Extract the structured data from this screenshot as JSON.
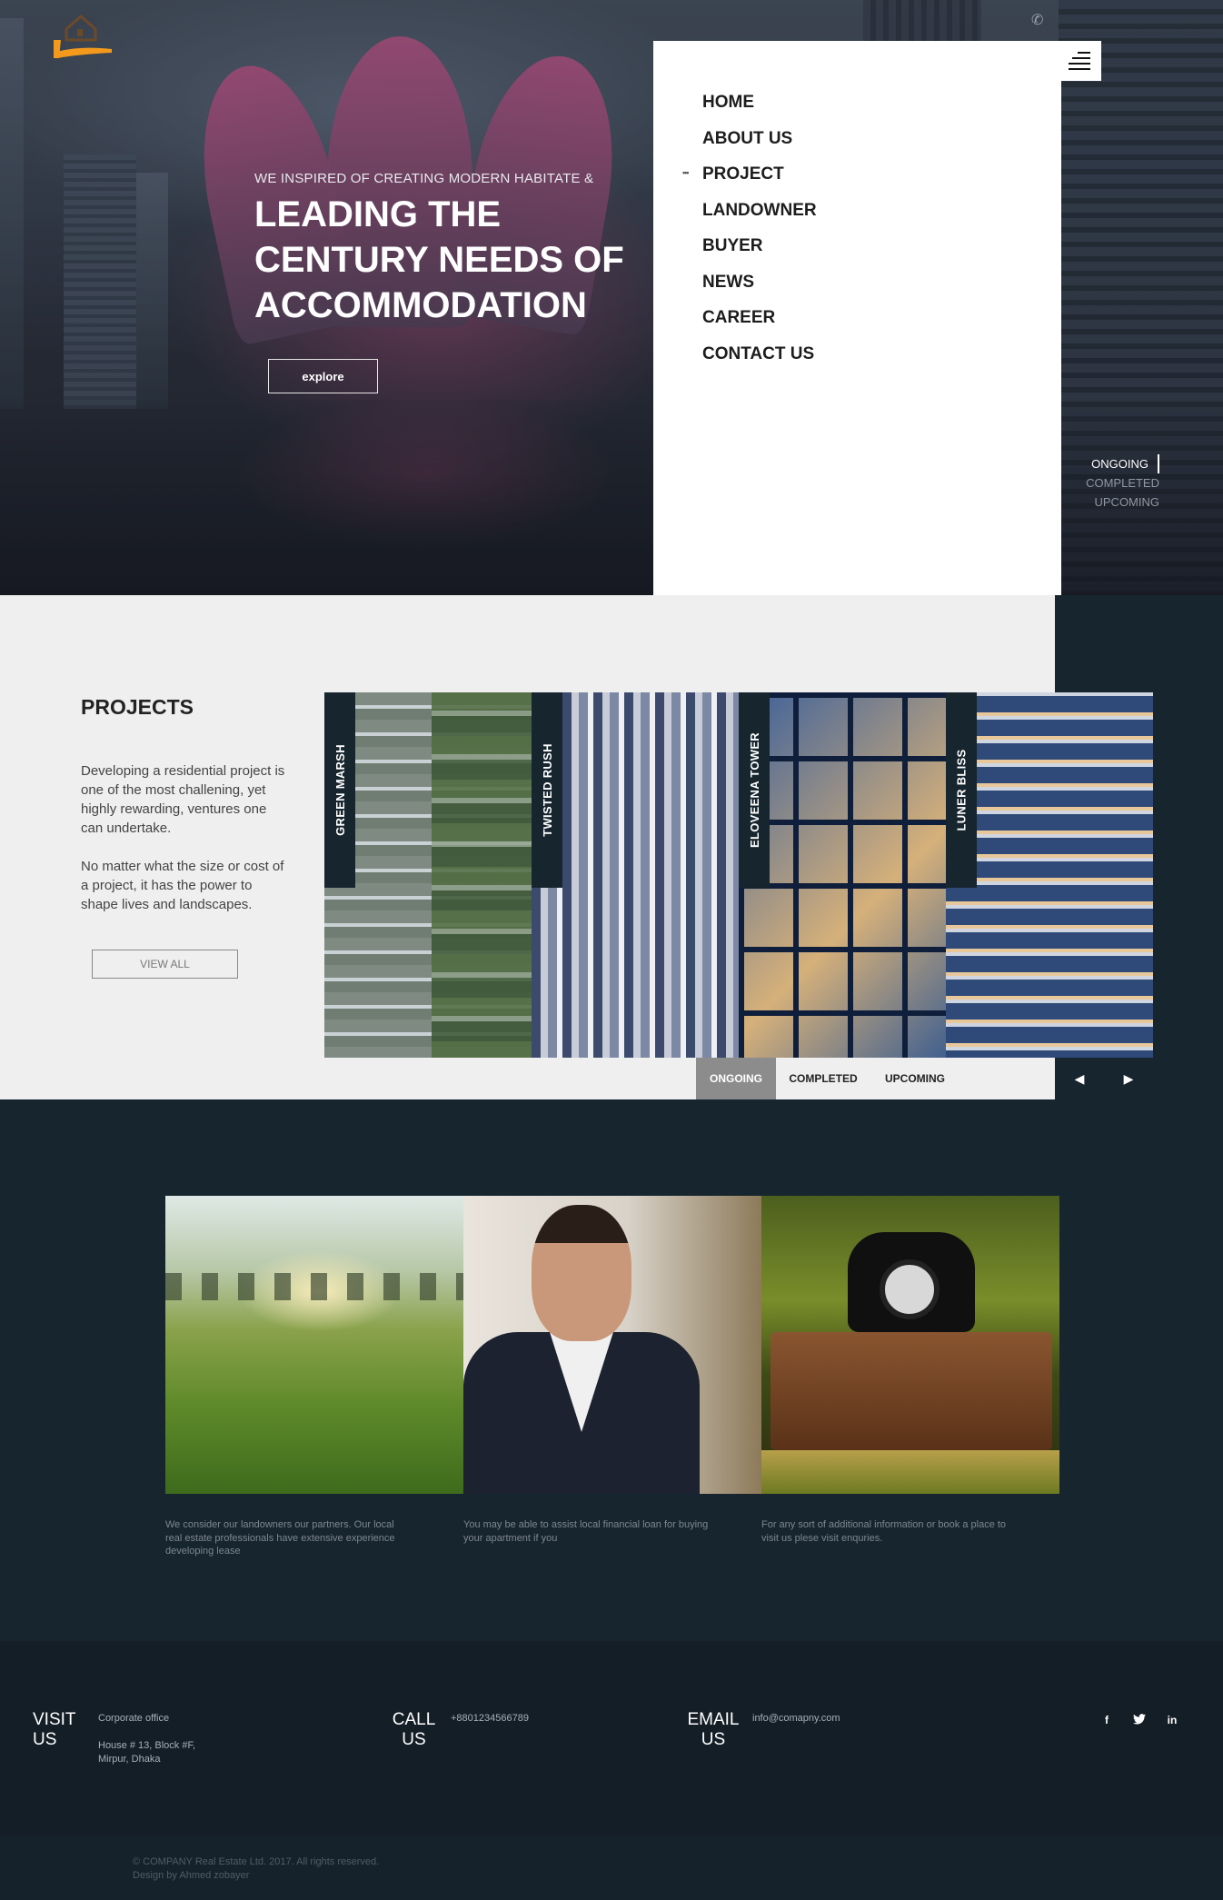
{
  "nav": {
    "items": [
      {
        "label": "HOME",
        "active": false
      },
      {
        "label": "ABOUT US",
        "active": false
      },
      {
        "label": "PROJECT",
        "active": true
      },
      {
        "label": "LANDOWNER",
        "active": false
      },
      {
        "label": "BUYER",
        "active": false
      },
      {
        "label": "NEWS",
        "active": false
      },
      {
        "label": "CAREER",
        "active": false
      },
      {
        "label": "CONTACT US",
        "active": false
      }
    ]
  },
  "hero": {
    "kicker": "WE INSPIRED OF CREATING MODERN HABITATE &",
    "title": "LEADING THE CENTURY NEEDS OF ACCOMMODATION",
    "explore_label": "explore",
    "status": {
      "ongoing": "ONGOING",
      "completed": "COMPLETED",
      "upcoming": "UPCOMING"
    }
  },
  "projects": {
    "title": "PROJECTS",
    "paragraph1": "Developing a residential project is one of the most challening, yet highly rewarding, ventures one can undertake.",
    "paragraph2": "No matter what the size or cost of a project, it has the power to shape lives and landscapes.",
    "view_all_label": "VIEW ALL",
    "cards": [
      {
        "name": "GREEN MARSH"
      },
      {
        "name": "TWISTED RUSH"
      },
      {
        "name": "ELOVEENA TOWER"
      },
      {
        "name": "LUNER BLISS"
      }
    ],
    "tabs": [
      {
        "label": "ONGOING",
        "active": true
      },
      {
        "label": "COMPLETED",
        "active": false
      },
      {
        "label": "UPCOMING",
        "active": false
      }
    ],
    "prev_icon": "◀",
    "next_icon": "▶"
  },
  "services": [
    {
      "text": "We consider our landowners our partners. Our local real estate professionals have extensive experience developing lease"
    },
    {
      "text": "You may be able to assist local financial loan for buying your apartment if you"
    },
    {
      "text": "For any sort of additional information or book a place to visit us plese visit enquries."
    }
  ],
  "footer": {
    "visit": {
      "heading": "VISIT US",
      "label": "Corporate office",
      "address": "House # 13, Block #F, Mirpur, Dhaka"
    },
    "call": {
      "heading": "CALL US",
      "value": "+8801234566789"
    },
    "email": {
      "heading": "EMAIL US",
      "value": "info@comapny.com"
    },
    "social": {
      "facebook": "f",
      "twitter": "t",
      "linkedin": "in"
    }
  },
  "copyright": {
    "line1": "© COMPANY Real Estate Ltd. 2017. All rights reserved.",
    "line2": "Design by Ahmed zobayer"
  },
  "colors": {
    "accent": "#f39a1c",
    "dark": "#17252f",
    "light_bg": "#efefef"
  }
}
